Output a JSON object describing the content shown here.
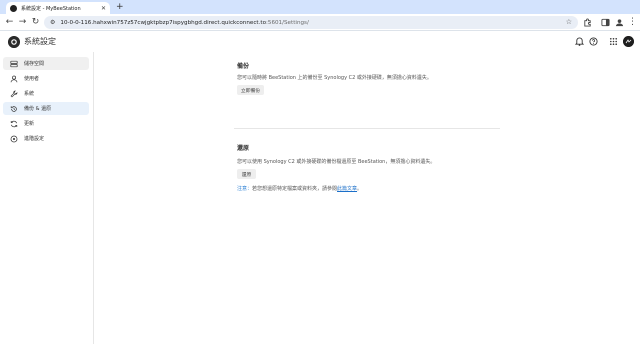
{
  "browser": {
    "tab_title": "系統設定 - MyBeeStation",
    "url_main": "10-0-0-116.hahxwin757z57cwjgktpbzp7ispygbhgd.direct.quickconnect.to",
    "url_rest": ":5601/Settings/"
  },
  "app": {
    "title": "系統設定"
  },
  "sidebar": {
    "items": [
      {
        "label": "儲存空間",
        "icon": "storage-icon"
      },
      {
        "label": "使用者",
        "icon": "user-icon"
      },
      {
        "label": "系統",
        "icon": "wrench-icon"
      },
      {
        "label": "備份 & 還原",
        "icon": "backup-restore-icon"
      },
      {
        "label": "更新",
        "icon": "refresh-icon"
      },
      {
        "label": "進階設定",
        "icon": "advanced-settings-icon"
      }
    ]
  },
  "backup": {
    "title": "備份",
    "description": "您可以隨時將 BeeStation 上的備份至 Synology C2 或外接硬碟，無須擔心資料遺失。",
    "button": "立即備份"
  },
  "restore": {
    "title": "還原",
    "description": "您可以使用 Synology C2 或外接硬碟的備份檔還原至 BeeStation，無須擔心資料遺失。",
    "button": "還原"
  },
  "note": {
    "label": "注意：",
    "text": "若您想還原特定檔案或資料夾，請參閱",
    "link": "此篇文章",
    "end": "。"
  },
  "colors": {
    "accent": "#2a7fd4",
    "tabstrip": "#d3e3fd",
    "active_item": "#e8f1fb"
  }
}
